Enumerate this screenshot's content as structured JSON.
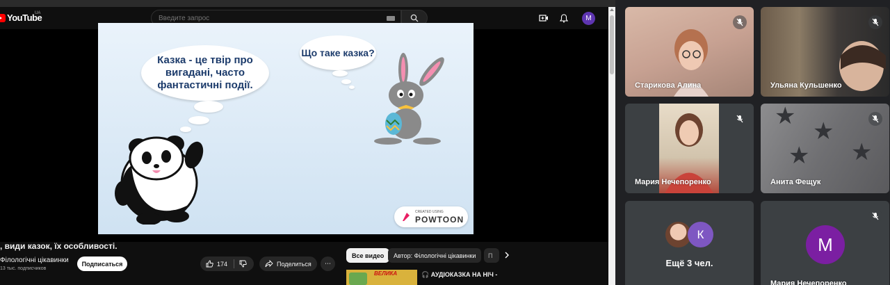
{
  "youtube": {
    "logo_text": "YouTube",
    "country": "UA",
    "search_placeholder": "Введите запрос",
    "avatar_letter": "M"
  },
  "video": {
    "bubble_left": "Казка - це твір про вигадані, часто фантастичні події.",
    "bubble_right": "Що таке казка?",
    "powtoon_small": "CREATED USING",
    "powtoon_big": "POWTOON"
  },
  "details": {
    "title": ", види казок, їх особливості.",
    "channel": "Філологічні цікавинки",
    "subscribers": "13 тыс. подписчиков",
    "subscribe_label": "Подписаться",
    "likes": "174",
    "share_label": "Поделиться",
    "more_label": "⋯"
  },
  "chips": [
    {
      "label": "Все видео",
      "active": true
    },
    {
      "label": "Автор: Філологічні цікавинки",
      "active": false
    },
    {
      "label": "П",
      "active": false
    }
  ],
  "recommendation": {
    "thumb_text": "ВЕЛИКА",
    "title": "🎧 АУДІОКАЗКА НА НІЧ -"
  },
  "meet": {
    "tiles": [
      {
        "name": "Старикова Алина"
      },
      {
        "name": "Ульяна Кульшенко"
      },
      {
        "name": "Мария Нечепоренко"
      },
      {
        "name": "Анита Фещук"
      },
      {
        "name": "Ещё 3 чел.",
        "avatar_letter": "К"
      },
      {
        "name": "Мария Нечепоренко",
        "avatar_letter": "M"
      }
    ]
  },
  "colors": {
    "youtube_red": "#ff0000",
    "meet_bg": "#202124",
    "tile_bg": "#3c4043",
    "avatar_purple": "#7b1fa2",
    "avatar_k": "#7e57c2"
  }
}
